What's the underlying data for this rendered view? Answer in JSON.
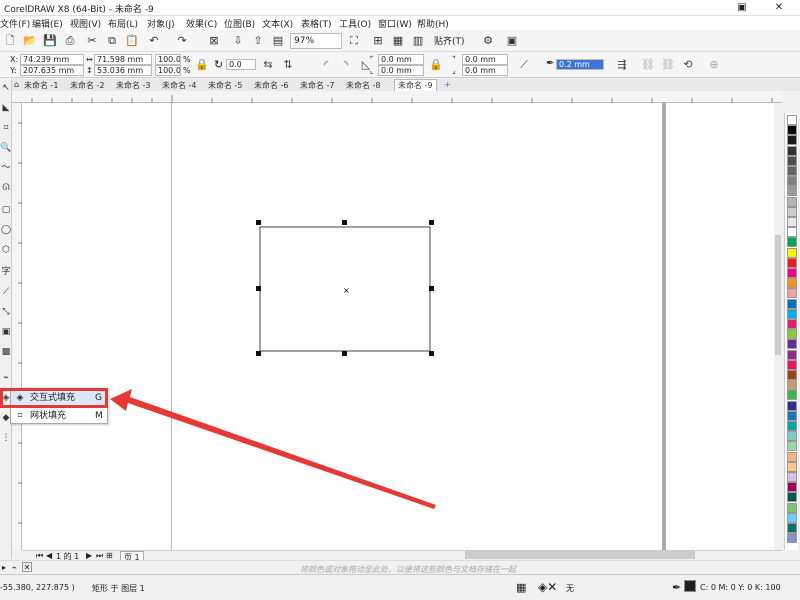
{
  "titlebar": {
    "title": "CorelDRAW X8 (64-Bit) - 未命名 -9"
  },
  "menus": [
    "文件(F)",
    "编辑(E)",
    "视图(V)",
    "布局(L)",
    "对象(J)",
    "效果(C)",
    "位图(B)",
    "文本(X)",
    "表格(T)",
    "工具(O)",
    "窗口(W)",
    "帮助(H)"
  ],
  "toolbar": {
    "zoom": "97%",
    "snap_label": "贴齐(T)"
  },
  "propbar": {
    "x": "74.239 mm",
    "y": "207.635 mm",
    "width": "71.598 mm",
    "height": "53.036 mm",
    "scale_x": "100.0",
    "scale_y": "100.0",
    "percent_sign": "%",
    "rotation": "0.0",
    "corner1": "0.0 mm",
    "corner2": "0.0 mm",
    "corner3": "0.0 mm",
    "corner4": "0.0 mm",
    "outline": "0.2 mm"
  },
  "tabs": [
    "未命名 -1",
    "未命名 -2",
    "未命名 -3",
    "未命名 -4",
    "未命名 -5",
    "未命名 -6",
    "未命名 -7",
    "未命名 -8",
    "未命名 -9"
  ],
  "flyout": {
    "items": [
      {
        "label": "交互式填充",
        "shortcut": "G"
      },
      {
        "label": "网状填充",
        "shortcut": "M"
      }
    ]
  },
  "pagenav": {
    "page_info": "1 的 1",
    "page_tab": "页 1"
  },
  "hint": "将颜色或对象拖动至此处，以便将这些颜色与文档存储在一起",
  "status": {
    "coords": "-55.380, 227.875 )",
    "object_info": "矩形 于 图层 1",
    "fill_none": "无",
    "color_info": "C: 0 M: 0 Y: 0 K: 100"
  },
  "palette_colors": [
    "#ffffff",
    "#000000",
    "#1a1a1a",
    "#333333",
    "#4d4d4d",
    "#666666",
    "#808080",
    "#999999",
    "#b3b3b3",
    "#cccccc",
    "#e6e6e6",
    "#ffffff",
    "#00a651",
    "#fff200",
    "#ed1c24",
    "#ec008c",
    "#f7941d",
    "#f5a0a0",
    "#0072bc",
    "#00aeef",
    "#e11d74",
    "#8dc63f",
    "#662d91",
    "#92278f",
    "#ed145b",
    "#a0410d",
    "#c69c6d",
    "#3ab54a",
    "#2e3192",
    "#1b75bc",
    "#00a99d",
    "#7accc8",
    "#a1d4a8",
    "#f9ad81",
    "#fdc689",
    "#d2c0e0",
    "#9e005d",
    "#005952",
    "#7cc576",
    "#6dcff6",
    "#00746b",
    "#8393ca"
  ]
}
